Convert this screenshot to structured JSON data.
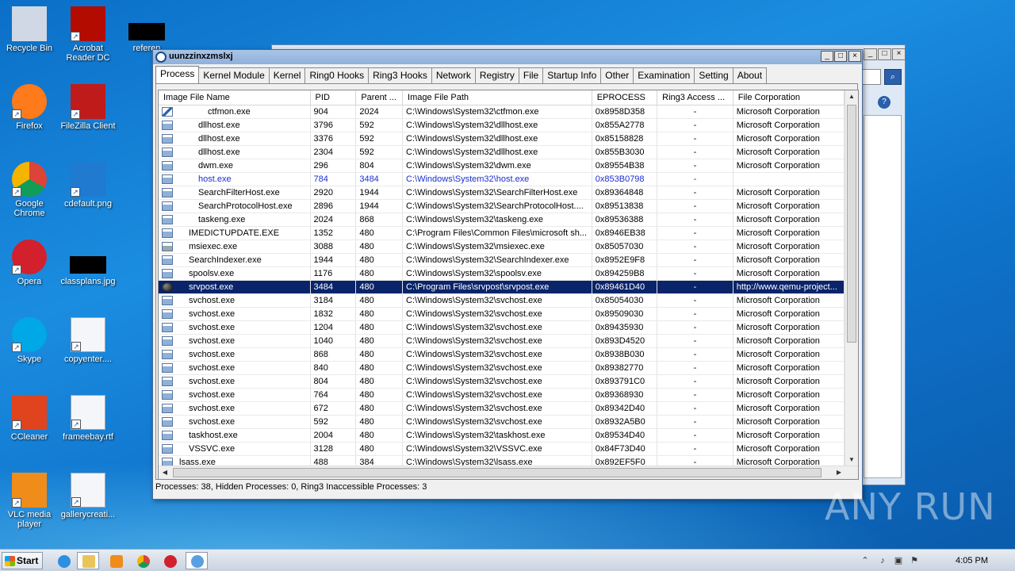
{
  "desktop": {
    "icons": [
      {
        "label": "Recycle Bin",
        "icon": "recycle-bin-icon"
      },
      {
        "label": "Acrobat Reader DC",
        "icon": "acrobat-icon"
      },
      {
        "label": "referen",
        "icon": "document-icon"
      },
      {
        "label": "Firefox",
        "icon": "firefox-icon"
      },
      {
        "label": "FileZilla Client",
        "icon": "filezilla-icon"
      },
      {
        "label": "Google Chrome",
        "icon": "chrome-icon"
      },
      {
        "label": "cdefault.png",
        "icon": "image-icon"
      },
      {
        "label": "Opera",
        "icon": "opera-icon"
      },
      {
        "label": "classplans.jpg",
        "icon": "image-icon"
      },
      {
        "label": "Skype",
        "icon": "skype-icon"
      },
      {
        "label": "copyenter....",
        "icon": "word-doc-icon"
      },
      {
        "label": "CCleaner",
        "icon": "ccleaner-icon"
      },
      {
        "label": "frameebay.rtf",
        "icon": "word-doc-icon"
      },
      {
        "label": "VLC media player",
        "icon": "vlc-icon"
      },
      {
        "label": "gallerycreati...",
        "icon": "word-doc-icon"
      }
    ]
  },
  "window": {
    "title": "uunzzinxzmslxj",
    "minimize": "_",
    "maximize": "□",
    "close": "×"
  },
  "tabs": [
    "Process",
    "Kernel Module",
    "Kernel",
    "Ring0 Hooks",
    "Ring3 Hooks",
    "Network",
    "Registry",
    "File",
    "Startup Info",
    "Other",
    "Examination",
    "Setting",
    "About"
  ],
  "active_tab": "Process",
  "table": {
    "columns": [
      "Image File Name",
      "PID",
      "Parent ...",
      "Image File Path",
      "EPROCESS",
      "Ring3 Access ...",
      "File Corporation"
    ],
    "rows": [
      {
        "name": "ctfmon.exe",
        "indent": 3,
        "pid": "904",
        "ppid": "2024",
        "path": "C:\\Windows\\System32\\ctfmon.exe",
        "eprocess": "0x8958D358",
        "ring3": "-",
        "corp": "Microsoft Corporation",
        "icon": "pen-icon"
      },
      {
        "name": "dllhost.exe",
        "indent": 2,
        "pid": "3796",
        "ppid": "592",
        "path": "C:\\Windows\\System32\\dllhost.exe",
        "eprocess": "0x855A2778",
        "ring3": "-",
        "corp": "Microsoft Corporation",
        "icon": "window-icon"
      },
      {
        "name": "dllhost.exe",
        "indent": 2,
        "pid": "3376",
        "ppid": "592",
        "path": "C:\\Windows\\System32\\dllhost.exe",
        "eprocess": "0x85158828",
        "ring3": "-",
        "corp": "Microsoft Corporation",
        "icon": "window-icon"
      },
      {
        "name": "dllhost.exe",
        "indent": 2,
        "pid": "2304",
        "ppid": "592",
        "path": "C:\\Windows\\System32\\dllhost.exe",
        "eprocess": "0x855B3030",
        "ring3": "-",
        "corp": "Microsoft Corporation",
        "icon": "window-icon"
      },
      {
        "name": "dwm.exe",
        "indent": 2,
        "pid": "296",
        "ppid": "804",
        "path": "C:\\Windows\\System32\\dwm.exe",
        "eprocess": "0x89554B38",
        "ring3": "-",
        "corp": "Microsoft Corporation",
        "icon": "window-icon"
      },
      {
        "name": "host.exe",
        "indent": 2,
        "pid": "784",
        "ppid": "3484",
        "path": "C:\\Windows\\System32\\host.exe",
        "eprocess": "0x853B0798",
        "ring3": "-",
        "corp": "",
        "icon": "window-icon",
        "blue": true
      },
      {
        "name": "SearchFilterHost.exe",
        "indent": 2,
        "pid": "2920",
        "ppid": "1944",
        "path": "C:\\Windows\\System32\\SearchFilterHost.exe",
        "eprocess": "0x89364848",
        "ring3": "-",
        "corp": "Microsoft Corporation",
        "icon": "window-icon"
      },
      {
        "name": "SearchProtocolHost.exe",
        "indent": 2,
        "pid": "2896",
        "ppid": "1944",
        "path": "C:\\Windows\\System32\\SearchProtocolHost....",
        "eprocess": "0x89513838",
        "ring3": "-",
        "corp": "Microsoft Corporation",
        "icon": "window-icon"
      },
      {
        "name": "taskeng.exe",
        "indent": 2,
        "pid": "2024",
        "ppid": "868",
        "path": "C:\\Windows\\System32\\taskeng.exe",
        "eprocess": "0x89536388",
        "ring3": "-",
        "corp": "Microsoft Corporation",
        "icon": "window-icon"
      },
      {
        "name": "IMEDICTUPDATE.EXE",
        "indent": 1,
        "pid": "1352",
        "ppid": "480",
        "path": "C:\\Program Files\\Common Files\\microsoft sh...",
        "eprocess": "0x8946EB38",
        "ring3": "-",
        "corp": "Microsoft Corporation",
        "icon": "window-icon"
      },
      {
        "name": "msiexec.exe",
        "indent": 1,
        "pid": "3088",
        "ppid": "480",
        "path": "C:\\Windows\\System32\\msiexec.exe",
        "eprocess": "0x85057030",
        "ring3": "-",
        "corp": "Microsoft Corporation",
        "icon": "installer-icon"
      },
      {
        "name": "SearchIndexer.exe",
        "indent": 1,
        "pid": "1944",
        "ppid": "480",
        "path": "C:\\Windows\\System32\\SearchIndexer.exe",
        "eprocess": "0x8952E9F8",
        "ring3": "-",
        "corp": "Microsoft Corporation",
        "icon": "window-icon"
      },
      {
        "name": "spoolsv.exe",
        "indent": 1,
        "pid": "1176",
        "ppid": "480",
        "path": "C:\\Windows\\System32\\spoolsv.exe",
        "eprocess": "0x894259B8",
        "ring3": "-",
        "corp": "Microsoft Corporation",
        "icon": "window-icon"
      },
      {
        "name": "srvpost.exe",
        "indent": 1,
        "pid": "3484",
        "ppid": "480",
        "path": "C:\\Program Files\\srvpost\\srvpost.exe",
        "eprocess": "0x89461D40",
        "ring3": "-",
        "corp": "http://www.qemu-project...",
        "icon": "ball-icon",
        "selected": true
      },
      {
        "name": "svchost.exe",
        "indent": 1,
        "pid": "3184",
        "ppid": "480",
        "path": "C:\\Windows\\System32\\svchost.exe",
        "eprocess": "0x85054030",
        "ring3": "-",
        "corp": "Microsoft Corporation",
        "icon": "window-icon"
      },
      {
        "name": "svchost.exe",
        "indent": 1,
        "pid": "1832",
        "ppid": "480",
        "path": "C:\\Windows\\System32\\svchost.exe",
        "eprocess": "0x89509030",
        "ring3": "-",
        "corp": "Microsoft Corporation",
        "icon": "window-icon"
      },
      {
        "name": "svchost.exe",
        "indent": 1,
        "pid": "1204",
        "ppid": "480",
        "path": "C:\\Windows\\System32\\svchost.exe",
        "eprocess": "0x89435930",
        "ring3": "-",
        "corp": "Microsoft Corporation",
        "icon": "window-icon"
      },
      {
        "name": "svchost.exe",
        "indent": 1,
        "pid": "1040",
        "ppid": "480",
        "path": "C:\\Windows\\System32\\svchost.exe",
        "eprocess": "0x893D4520",
        "ring3": "-",
        "corp": "Microsoft Corporation",
        "icon": "window-icon"
      },
      {
        "name": "svchost.exe",
        "indent": 1,
        "pid": "868",
        "ppid": "480",
        "path": "C:\\Windows\\System32\\svchost.exe",
        "eprocess": "0x8938B030",
        "ring3": "-",
        "corp": "Microsoft Corporation",
        "icon": "window-icon"
      },
      {
        "name": "svchost.exe",
        "indent": 1,
        "pid": "840",
        "ppid": "480",
        "path": "C:\\Windows\\System32\\svchost.exe",
        "eprocess": "0x89382770",
        "ring3": "-",
        "corp": "Microsoft Corporation",
        "icon": "window-icon"
      },
      {
        "name": "svchost.exe",
        "indent": 1,
        "pid": "804",
        "ppid": "480",
        "path": "C:\\Windows\\System32\\svchost.exe",
        "eprocess": "0x893791C0",
        "ring3": "-",
        "corp": "Microsoft Corporation",
        "icon": "window-icon"
      },
      {
        "name": "svchost.exe",
        "indent": 1,
        "pid": "764",
        "ppid": "480",
        "path": "C:\\Windows\\System32\\svchost.exe",
        "eprocess": "0x89368930",
        "ring3": "-",
        "corp": "Microsoft Corporation",
        "icon": "window-icon"
      },
      {
        "name": "svchost.exe",
        "indent": 1,
        "pid": "672",
        "ppid": "480",
        "path": "C:\\Windows\\System32\\svchost.exe",
        "eprocess": "0x89342D40",
        "ring3": "-",
        "corp": "Microsoft Corporation",
        "icon": "window-icon"
      },
      {
        "name": "svchost.exe",
        "indent": 1,
        "pid": "592",
        "ppid": "480",
        "path": "C:\\Windows\\System32\\svchost.exe",
        "eprocess": "0x8932A5B0",
        "ring3": "-",
        "corp": "Microsoft Corporation",
        "icon": "window-icon"
      },
      {
        "name": "taskhost.exe",
        "indent": 1,
        "pid": "2004",
        "ppid": "480",
        "path": "C:\\Windows\\System32\\taskhost.exe",
        "eprocess": "0x89534D40",
        "ring3": "-",
        "corp": "Microsoft Corporation",
        "icon": "window-icon"
      },
      {
        "name": "VSSVC.exe",
        "indent": 1,
        "pid": "3128",
        "ppid": "480",
        "path": "C:\\Windows\\System32\\VSSVC.exe",
        "eprocess": "0x84F73D40",
        "ring3": "-",
        "corp": "Microsoft Corporation",
        "icon": "window-icon"
      },
      {
        "name": "lsass.exe",
        "indent": 0,
        "pid": "488",
        "ppid": "384",
        "path": "C:\\Windows\\System32\\lsass.exe",
        "eprocess": "0x892EF5F0",
        "ring3": "-",
        "corp": "Microsoft Corporation",
        "icon": "window-icon"
      }
    ]
  },
  "status": "Processes: 38, Hidden Processes: 0, Ring3 Inaccessible Processes: 3",
  "taskbar": {
    "start_label": "Start",
    "clock": "4:05 PM"
  },
  "watermark": "ANY RUN"
}
